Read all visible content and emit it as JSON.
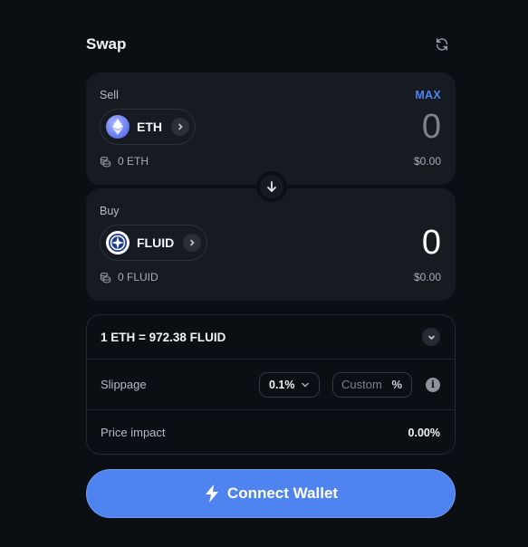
{
  "header": {
    "title": "Swap",
    "refresh_icon": "refresh-icon"
  },
  "sell": {
    "label": "Sell",
    "max_label": "MAX",
    "token": {
      "symbol": "ETH",
      "icon": "eth-logo-icon"
    },
    "amount": "0",
    "balance": "0 ETH",
    "usd_value": "$0.00"
  },
  "buy": {
    "label": "Buy",
    "token": {
      "symbol": "FLUID",
      "icon": "fluid-logo-icon"
    },
    "amount": "0",
    "balance": "0 FLUID",
    "usd_value": "$0.00"
  },
  "details": {
    "rate": "1 ETH = 972.38 FLUID",
    "slippage_label": "Slippage",
    "slippage_value": "0.1%",
    "custom_placeholder": "Custom",
    "custom_suffix": "%",
    "price_impact_label": "Price impact",
    "price_impact_value": "0.00%"
  },
  "connect_button": {
    "label": "Connect Wallet",
    "icon": "lightning-icon"
  },
  "colors": {
    "accent": "#4f84f0",
    "max_link": "#4d84f5",
    "background": "#0b0e13",
    "panel": "#161a21"
  }
}
